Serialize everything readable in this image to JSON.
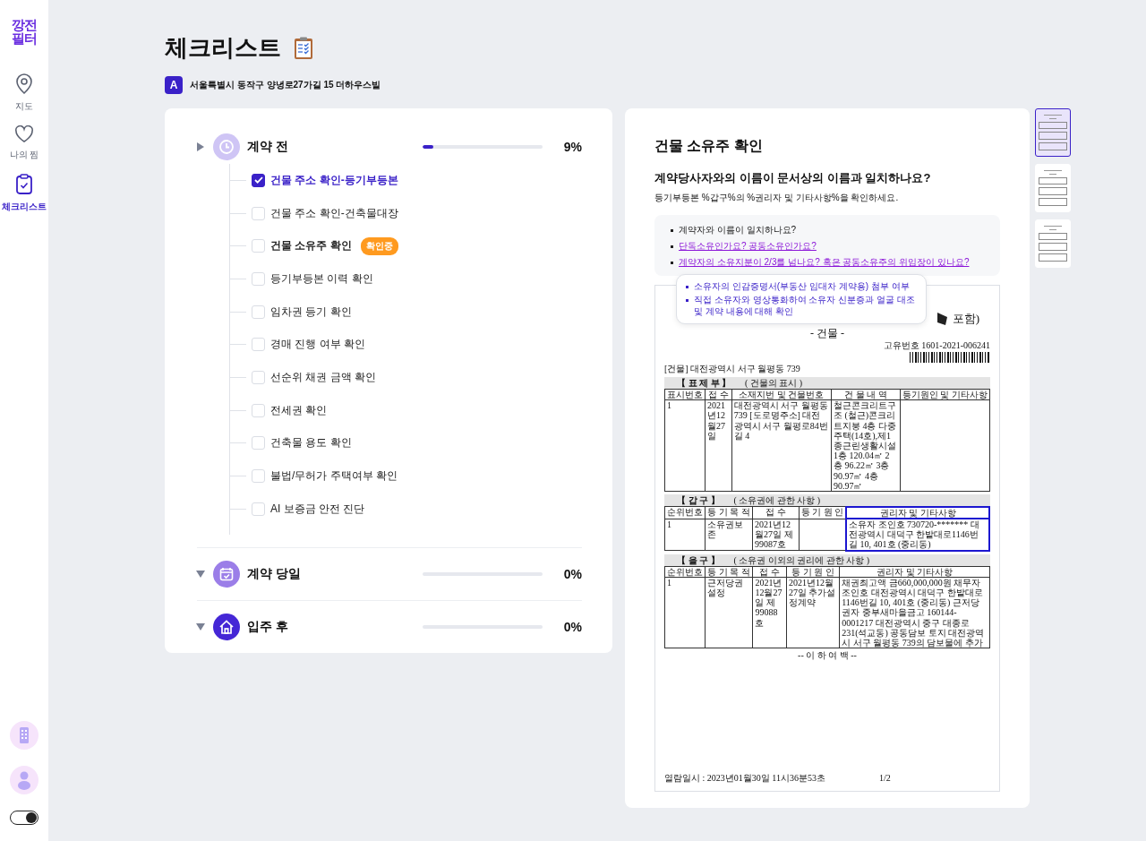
{
  "sidebar": {
    "logo": [
      "깡전",
      "필터"
    ],
    "items": [
      {
        "label": "지도",
        "selected": false
      },
      {
        "label": "나의 찜",
        "selected": false
      },
      {
        "label": "체크리스트",
        "selected": true
      }
    ],
    "theme_toggle": {
      "on": true
    }
  },
  "page": {
    "title": "체크리스트",
    "address_badge": "A",
    "address": "서울특별시 동작구 양녕로27가길 15 더하우스빌"
  },
  "checklist": [
    {
      "title": "계약 전",
      "color": "#cfc5f5",
      "expanded": true,
      "level": 0.09,
      "percent": "9%",
      "items": [
        {
          "label": "건물 주소 확인-등기부등본",
          "checked": true,
          "selected": false
        },
        {
          "label": "건물 주소 확인-건축물대장",
          "checked": false,
          "selected": false
        },
        {
          "label": "건물 소유주 확인",
          "checked": false,
          "selected": true,
          "badge": "확인중"
        },
        {
          "label": "등기부등본 이력 확인",
          "checked": false,
          "selected": false
        },
        {
          "label": "임차권 등기 확인",
          "checked": false,
          "selected": false
        },
        {
          "label": "경매 진행 여부 확인",
          "checked": false,
          "selected": false
        },
        {
          "label": "선순위 채권 금액 확인",
          "checked": false,
          "selected": false
        },
        {
          "label": "전세권 확인",
          "checked": false,
          "selected": false
        },
        {
          "label": "건축물 용도 확인",
          "checked": false,
          "selected": false
        },
        {
          "label": "불법/무허가 주택여부 확인",
          "checked": false,
          "selected": false
        },
        {
          "label": "AI 보증금 안전 진단",
          "checked": false,
          "selected": false
        }
      ]
    },
    {
      "title": "계약 당일",
      "color": "#9b7ee8",
      "expanded": false,
      "level": 0,
      "percent": "0%"
    },
    {
      "title": "입주 후",
      "color": "#4527d6",
      "expanded": false,
      "level": 0,
      "percent": "0%"
    }
  ],
  "detail": {
    "title": "건물 소유주 확인",
    "question": "계약당사자와의 이름이 문서상의 이름과 일치하나요?",
    "hint": "등기부등본 %갑구%의 %권리자 및 기타사항%을 확인하세요.",
    "tips": [
      {
        "kind": "text",
        "text": "계약자와 이름이 일치하나요?"
      },
      {
        "kind": "link",
        "text": "단독소유인가요? 공동소유인가요?"
      },
      {
        "kind": "link",
        "text": "계약자의 소유지분이 2/3를 넘나요? 혹은 공동소유주의 위임장이 있나요?"
      }
    ],
    "tooltip": [
      "소유자의 인감증명서(부동산 임대차 계약용) 첨부 여부",
      "직접 소유자와 영상통화하여 소유자 신분증과 얼굴 대조 및 계약 내용에 대해 확인"
    ],
    "document": {
      "title_fragment": "포함)",
      "subtitle": "- 건물 -",
      "serial": "고유번호 1601-2021-006241",
      "address": "[건물] 대전광역시 서구 월평동 739",
      "sections": [
        {
          "heading": "【 표 제 부 】",
          "note": "( 건물의 표시 )",
          "highlighted": false,
          "columns": [
            "표시번호",
            "접 수",
            "소재지번 및 건물번호",
            "건 물 내 역",
            "등기원인 및 기타사항"
          ],
          "row": {
            "column_1": "1",
            "column_2": "2021년12월27일",
            "column_3": "대전광역시 서구 월평동 739 [도로명주소] 대전광역시 서구 월평로84번길 4",
            "column_4": "철근콘크리트구조 (철근)콘크리트지붕 4층 다중주택(14호),제1종근린생활시설 1층 120.04㎡ 2층 96.22㎡ 3층 90.97㎡ 4층 90.97㎡"
          }
        },
        {
          "heading": "【 갑 구 】",
          "note": "( 소유권에 관한 사항 )",
          "highlighted": true,
          "columns": [
            "순위번호",
            "등 기 목 적",
            "접 수",
            "등 기 원 인",
            "권리자 및 기타사항"
          ],
          "row": {
            "column_1": "1",
            "column_2": "소유권보존",
            "column_3": "2021년12월27일 제99087호",
            "column_5": "소유자 조인호 730720-******* 대전광역시 대덕구 한밭대로1146번길 10, 401호 (중리동)"
          }
        },
        {
          "heading": "【 을 구 】",
          "note": "( 소유권 이외의 권리에 관한 사항 )",
          "highlighted": false,
          "columns": [
            "순위번호",
            "등 기 목 적",
            "접 수",
            "등 기 원 인",
            "권리자 및 기타사항"
          ],
          "row": {
            "column_1": "1",
            "column_2": "근저당권설정",
            "column_3": "2021년12월27일 제99088호",
            "column_4": "2021년12월27일 추가설정계약",
            "column_5": "채권최고액 금660,000,000원 채무자 조인호 대전광역시 대덕구 한밭대로1146번길 10, 401호 (중리동) 근저당권자 중부새마을금고 160144-0001217 대전광역시 중구 대종로 231(석교동) 공동담보 토지 대전광역시 서구 월평동 739의 담보물에 추가"
          }
        }
      ],
      "end_note": "-- 이 하 여 백 --",
      "viewed_at": "열람일시 : 2023년01월30일 11시36분53초",
      "page": "1/2"
    }
  },
  "thumbnails": [
    {
      "selected": true
    },
    {
      "selected": false
    },
    {
      "selected": false
    }
  ]
}
